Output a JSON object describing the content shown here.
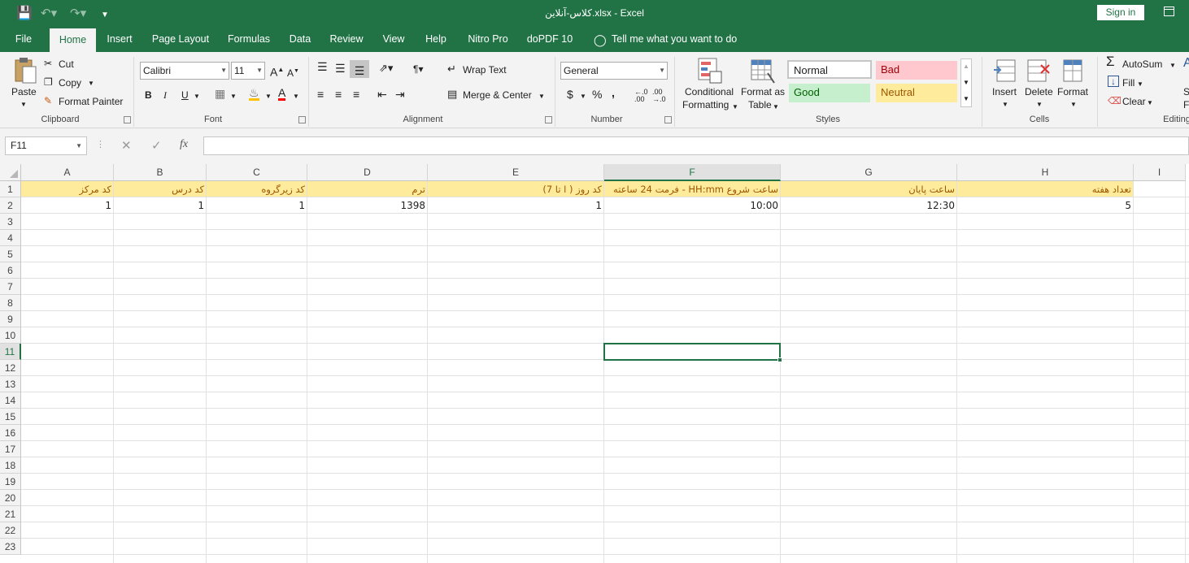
{
  "titlebar": {
    "title": "کلاس-آنلاین.xlsx  -  Excel",
    "sign_in": "Sign in"
  },
  "tabs": [
    "File",
    "Home",
    "Insert",
    "Page Layout",
    "Formulas",
    "Data",
    "Review",
    "View",
    "Help",
    "Nitro Pro",
    "doPDF 10",
    "Tell me what you want to do"
  ],
  "active_tab": "Home",
  "ribbon": {
    "clipboard": {
      "paste": "Paste",
      "cut": "Cut",
      "copy": "Copy",
      "format_painter": "Format Painter",
      "label": "Clipboard"
    },
    "font": {
      "name": "Calibri",
      "size": "11",
      "bold": "B",
      "italic": "I",
      "underline": "U",
      "label": "Font"
    },
    "alignment": {
      "wrap_text": "Wrap Text",
      "merge_center": "Merge & Center",
      "label": "Alignment"
    },
    "number": {
      "format": "General",
      "currency": "$",
      "percent": "%",
      "comma": ",",
      "label": "Number"
    },
    "styles": {
      "conditional": "Conditional",
      "formatting": "Formatting",
      "format_as": "Format as",
      "table": "Table",
      "normal": "Normal",
      "bad": "Bad",
      "good": "Good",
      "neutral": "Neutral",
      "label": "Styles"
    },
    "cells": {
      "insert": "Insert",
      "delete": "Delete",
      "format": "Format",
      "label": "Cells"
    },
    "editing": {
      "autosum": "AutoSum",
      "fill": "Fill",
      "clear": "Clear",
      "sort_a": "S",
      "sort_b": "Fi",
      "label": "Editing"
    }
  },
  "formula_bar": {
    "name_box": "F11",
    "fx": "fx",
    "formula": ""
  },
  "colors": {
    "accent": "#217346",
    "header_fill": "#ffeb9c",
    "header_text": "#9c5700",
    "bad": "#ffc7ce",
    "good": "#c6efce",
    "neutral": "#ffeb9c"
  },
  "sheet": {
    "columns": [
      "A",
      "B",
      "C",
      "D",
      "E",
      "F",
      "G",
      "H",
      "I"
    ],
    "selected_column": "F",
    "selected_row": 11,
    "rows": [
      [
        "کد مرکز",
        "کد درس",
        "کد زیرگروه",
        "ترم",
        "کد روز ( ا تا 7)",
        "ساعت شروع  HH:mm  - فرمت 24 ساعته",
        "ساعت پایان",
        "تعداد هفته",
        ""
      ],
      [
        "1",
        "1",
        "1",
        "1398",
        "1",
        "10:00",
        "12:30",
        "5",
        ""
      ]
    ],
    "row_numbers": [
      "1",
      "2",
      "3",
      "4",
      "5",
      "6",
      "7",
      "8",
      "9",
      "10",
      "11",
      "12",
      "13",
      "14",
      "15",
      "16",
      "17",
      "18",
      "19",
      "20",
      "21",
      "22",
      "23"
    ]
  }
}
